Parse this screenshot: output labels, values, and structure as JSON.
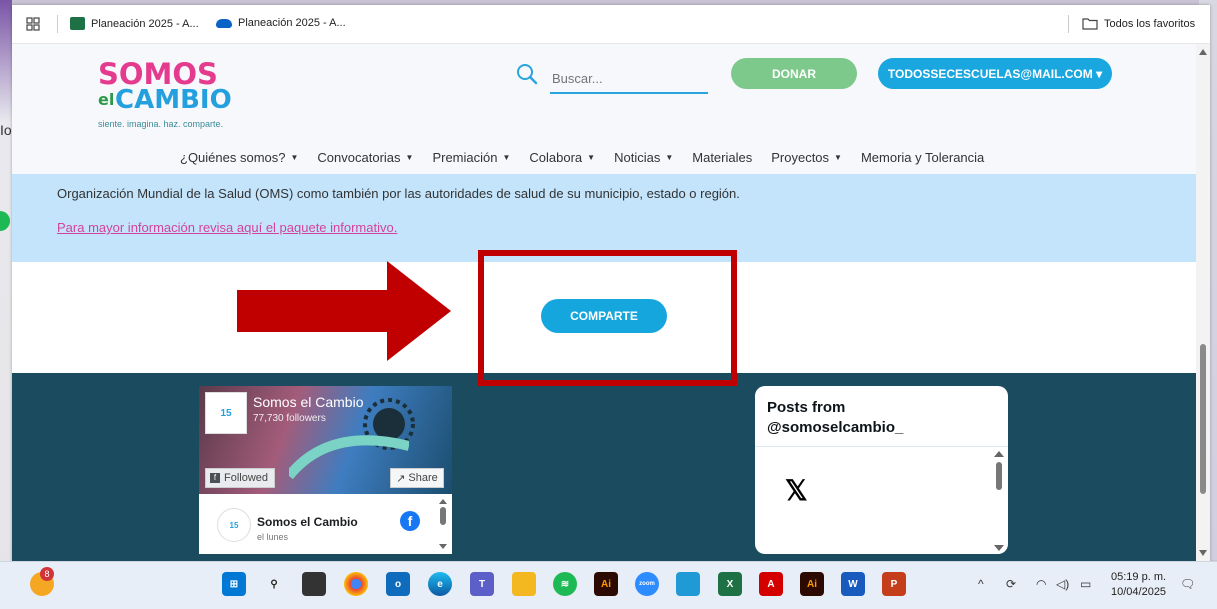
{
  "desktop": {
    "fragment_text": "Io"
  },
  "bookmarks": {
    "items": [
      {
        "label": "Planeación 2025 - A...",
        "icon": "excel-icon"
      },
      {
        "label": "Planeación 2025 - A...",
        "icon": "onedrive-icon"
      }
    ],
    "favorites_label": "Todos los favoritos"
  },
  "site": {
    "logo": {
      "line1": "SOMOS",
      "el": "el",
      "line2": "CAMBIO",
      "tagline": "siente. imagina. haz. comparte."
    },
    "search": {
      "placeholder": "Buscar..."
    },
    "donate_label": "DONAR",
    "account_label": "TODOSSECESCUELAS@MAIL.COM ▾",
    "nav": [
      {
        "label": "¿Quiénes somos?",
        "dropdown": true
      },
      {
        "label": "Convocatorias",
        "dropdown": true
      },
      {
        "label": "Premiación",
        "dropdown": true
      },
      {
        "label": "Colabora",
        "dropdown": true
      },
      {
        "label": "Noticias",
        "dropdown": true
      },
      {
        "label": "Materiales",
        "dropdown": false
      },
      {
        "label": "Proyectos",
        "dropdown": true
      },
      {
        "label": "Memoria y Tolerancia",
        "dropdown": false
      }
    ],
    "info_text": "Organización Mundial de la Salud (OMS) como también por las autoridades de salud de su municipio, estado o región.",
    "info_link": "Para mayor información revisa aquí el paquete informativo.",
    "share_button": "COMPARTE",
    "facebook": {
      "page_name": "Somos el Cambio",
      "followers": "77,730 followers",
      "followed_label": "Followed",
      "share_label": "Share",
      "post_author": "Somos el Cambio",
      "post_time": "el lunes"
    },
    "x_feed": {
      "title": "Posts from @somoselcambio_"
    }
  },
  "taskbar": {
    "notification_count": "8",
    "time": "05:19 p. m.",
    "date": "10/04/2025",
    "apps": [
      "windows-start",
      "search",
      "task-view",
      "chrome",
      "outlook",
      "edge",
      "teams",
      "file-explorer",
      "spotify",
      "illustrator",
      "zoom",
      "paint",
      "excel",
      "acrobat",
      "illustrator",
      "word",
      "powerpoint"
    ]
  },
  "colors": {
    "brand_blue": "#1aa6df",
    "brand_pink": "#e43b8f",
    "donate_green": "#7dc98b",
    "footer_teal": "#1a4b5e",
    "annotation_red": "#c00000"
  }
}
